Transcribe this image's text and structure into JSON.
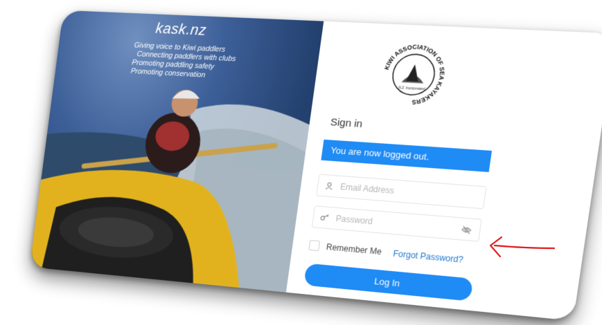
{
  "hero": {
    "brand": "kask.nz",
    "taglines": [
      "Giving voice to Kiwi paddlers",
      "Connecting paddlers with clubs",
      "Promoting paddling safety",
      "Promoting conservation"
    ]
  },
  "logo": {
    "ring_text": "KIWI ASSOCIATION OF SEA KAYAKERS",
    "inner_text": "N.Z. Incorporated"
  },
  "signin": {
    "title": "Sign in",
    "alert": "You are now logged out.",
    "email_placeholder": "Email Address",
    "password_placeholder": "Password",
    "remember_label": "Remember Me",
    "forgot_label": "Forgot Password?",
    "login_label": "Log In"
  },
  "icons": {
    "email": "user-icon",
    "password": "key-icon",
    "toggle": "eye-off-icon",
    "annotation": "red-arrow"
  },
  "colors": {
    "primary": "#1f8bf5",
    "link": "#1f78d1",
    "annotation": "#e02020"
  }
}
